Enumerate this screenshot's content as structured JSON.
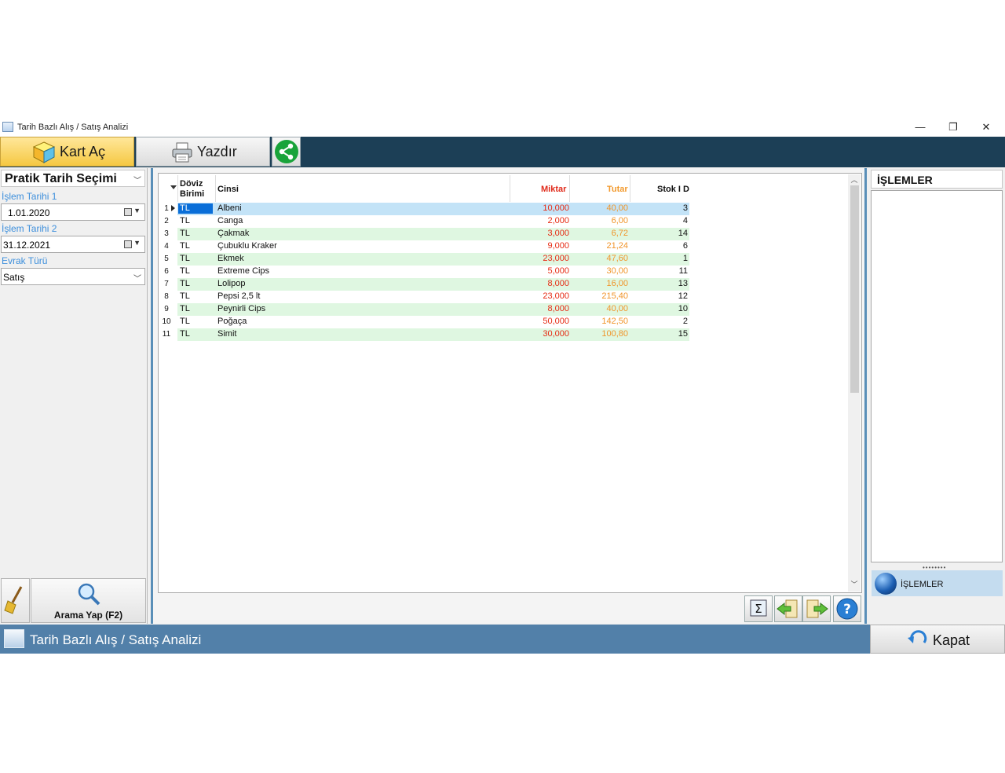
{
  "window": {
    "title": "Tarih Bazlı Alış / Satış Analizi",
    "minimize_glyph": "—",
    "restore_glyph": "❐",
    "close_glyph": "✕"
  },
  "toolbar": {
    "kart_label": "Kart Aç",
    "yazdir_label": "Yazdır"
  },
  "filters": {
    "section_title": "Pratik Tarih Seçimi",
    "date1_label": "İşlem Tarihi 1",
    "date1_value": "1.01.2020",
    "date2_label": "İşlem Tarihi 2",
    "date2_value": "31.12.2021",
    "doc_type_label": "Evrak Türü",
    "doc_type_value": "Satış",
    "search_button": "Arama Yap (F2)"
  },
  "grid": {
    "headers": {
      "doviz_line1": "Döviz",
      "doviz_line2": "Birimi",
      "cinsi": "Cinsi",
      "miktar": "Miktar",
      "tutar": "Tutar",
      "stok": "Stok I D"
    },
    "rows": [
      {
        "n": "1",
        "doviz": "TL",
        "cinsi": "Albeni",
        "miktar": "10,000",
        "tutar": "40,00",
        "stok": "3"
      },
      {
        "n": "2",
        "doviz": "TL",
        "cinsi": "Canga",
        "miktar": "2,000",
        "tutar": "6,00",
        "stok": "4"
      },
      {
        "n": "3",
        "doviz": "TL",
        "cinsi": "Çakmak",
        "miktar": "3,000",
        "tutar": "6,72",
        "stok": "14"
      },
      {
        "n": "4",
        "doviz": "TL",
        "cinsi": "Çubuklu Kraker",
        "miktar": "9,000",
        "tutar": "21,24",
        "stok": "6"
      },
      {
        "n": "5",
        "doviz": "TL",
        "cinsi": "Ekmek",
        "miktar": "23,000",
        "tutar": "47,60",
        "stok": "1"
      },
      {
        "n": "6",
        "doviz": "TL",
        "cinsi": "Extreme Cips",
        "miktar": "5,000",
        "tutar": "30,00",
        "stok": "11"
      },
      {
        "n": "7",
        "doviz": "TL",
        "cinsi": "Lolipop",
        "miktar": "8,000",
        "tutar": "16,00",
        "stok": "13"
      },
      {
        "n": "8",
        "doviz": "TL",
        "cinsi": "Pepsi 2,5 lt",
        "miktar": "23,000",
        "tutar": "215,40",
        "stok": "12"
      },
      {
        "n": "9",
        "doviz": "TL",
        "cinsi": "Peynirli Cips",
        "miktar": "8,000",
        "tutar": "40,00",
        "stok": "10"
      },
      {
        "n": "10",
        "doviz": "TL",
        "cinsi": "Poğaça",
        "miktar": "50,000",
        "tutar": "142,50",
        "stok": "2"
      },
      {
        "n": "11",
        "doviz": "TL",
        "cinsi": "Simit",
        "miktar": "30,000",
        "tutar": "100,80",
        "stok": "15"
      }
    ]
  },
  "actions": {
    "title": "İŞLEMLER",
    "item_label": "İŞLEMLER"
  },
  "status": {
    "title": "Tarih Bazlı Alış / Satış Analizi",
    "close_label": "Kapat"
  },
  "colors": {
    "selected_row": "#c3e3f7",
    "alt_row": "#dff7e1",
    "toolbar_bg": "#1c3f56",
    "status_bg": "#5280a9"
  }
}
